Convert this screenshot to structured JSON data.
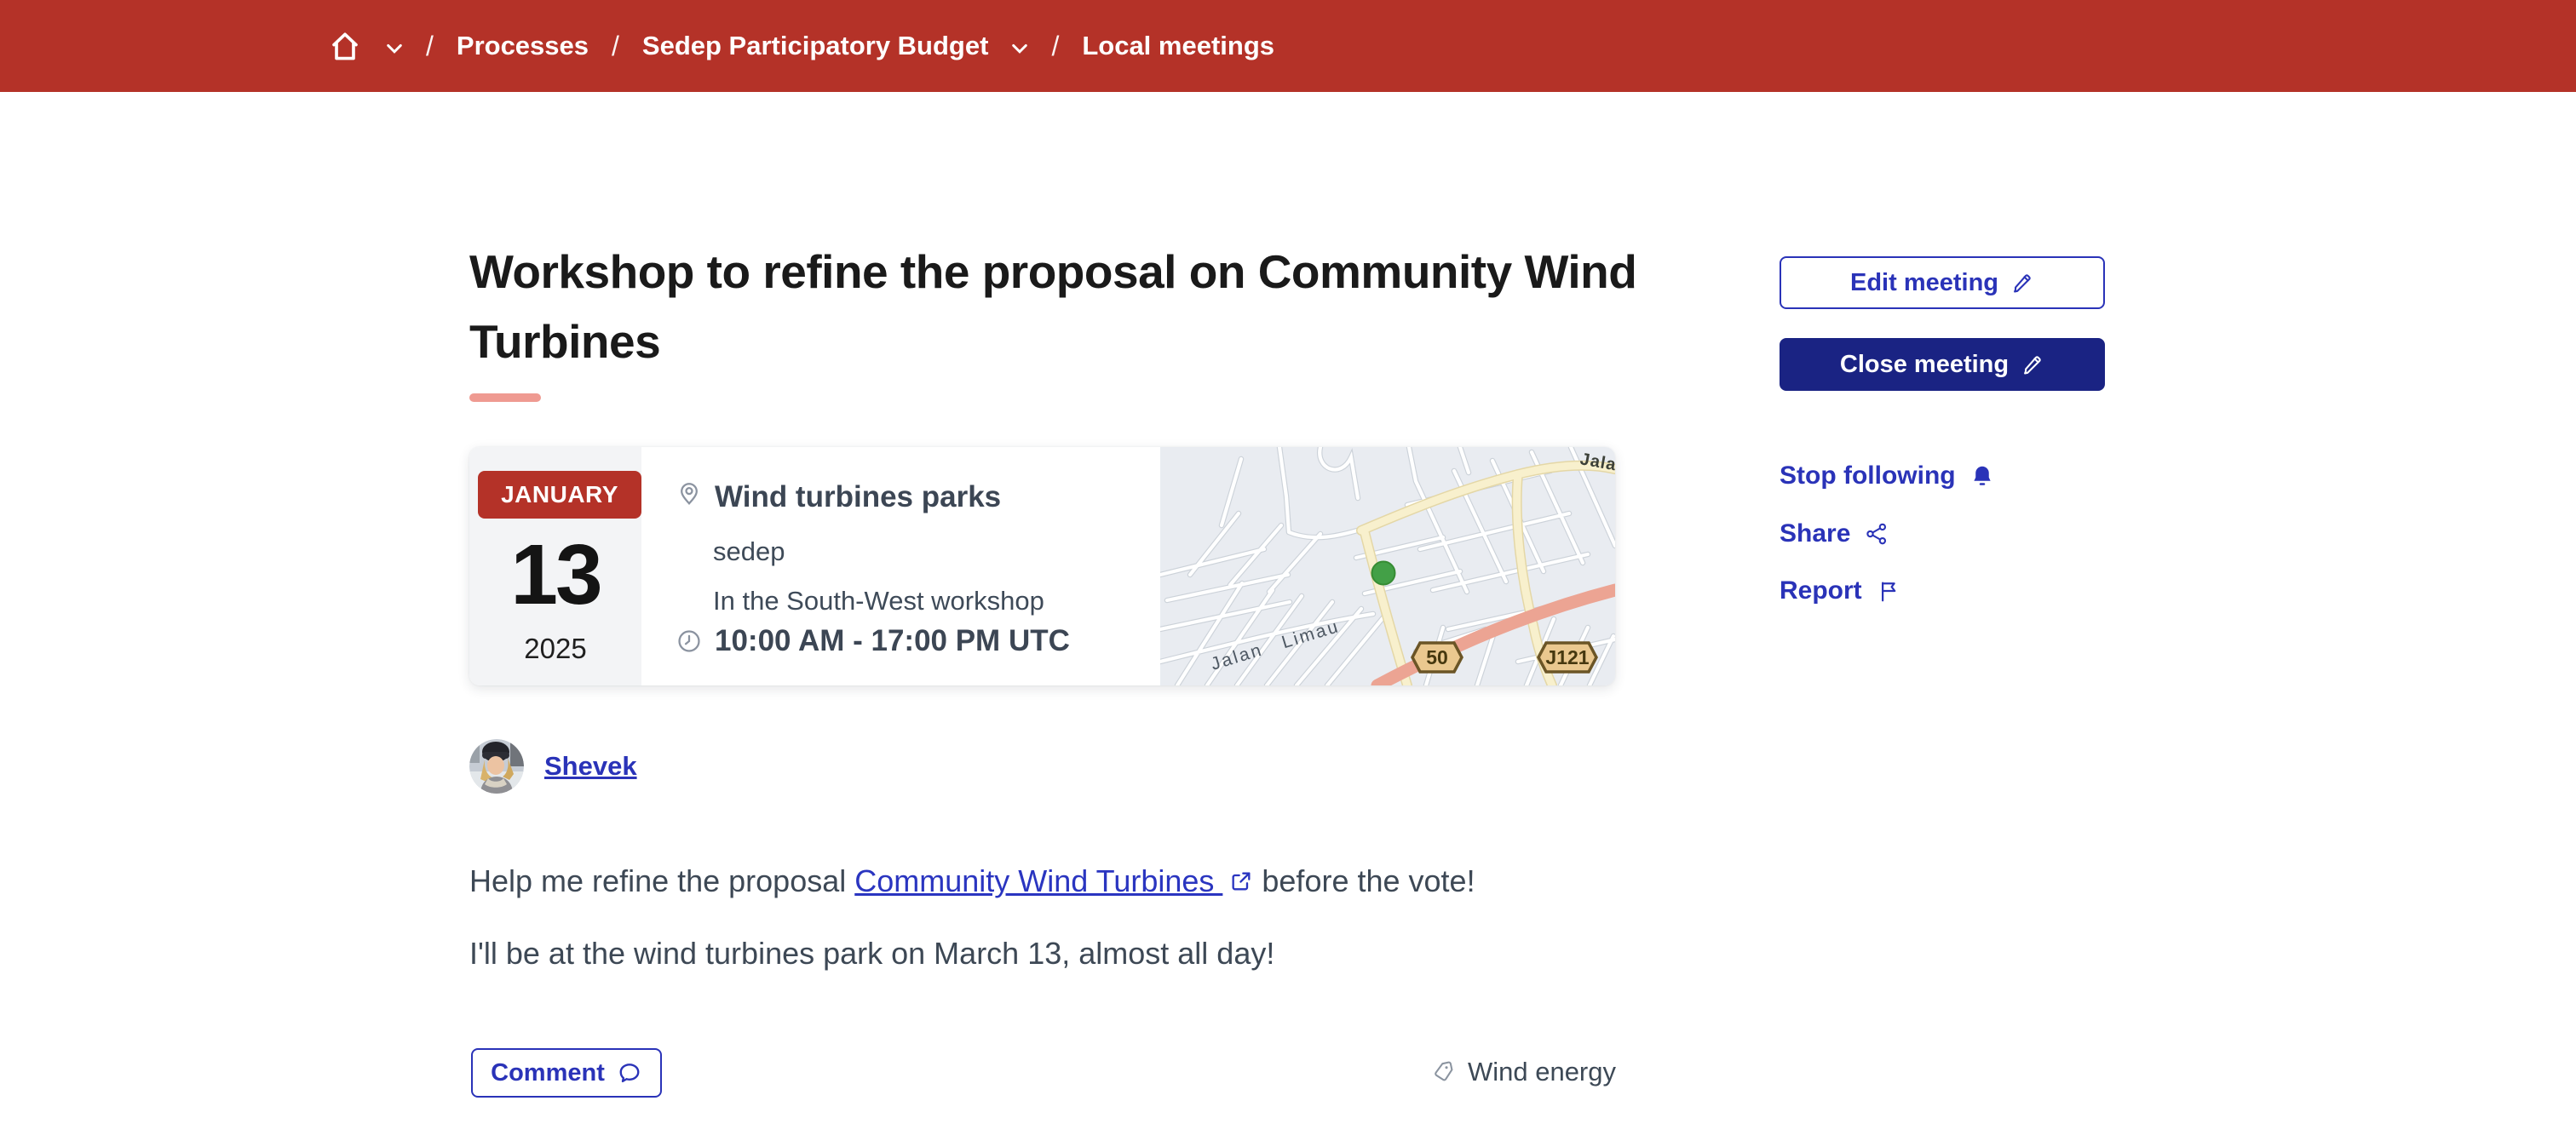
{
  "colors": {
    "topbar_red": "#b43228",
    "title_underline_salmon": "#ef9a91",
    "primary_blue": "#2a33b8",
    "close_button_navy": "#1a2383",
    "heading_text": "#1a1a1a",
    "body_text": "#3d4855",
    "card_gray": "#f3f4f6",
    "map_background": "#e9ecf1",
    "map_marker_green": "#43a047"
  },
  "breadcrumb": {
    "separator": "/",
    "items": [
      {
        "label": "Processes"
      },
      {
        "label": "Sedep Participatory Budget"
      },
      {
        "label": "Local meetings"
      }
    ]
  },
  "meeting": {
    "title": "Workshop to refine the proposal on Community Wind Turbines",
    "date": {
      "month": "JANUARY",
      "day": "13",
      "year": "2025"
    },
    "location": {
      "name": "Wind turbines parks",
      "org": "sedep",
      "detail": "In the South-West workshop"
    },
    "time": "10:00 AM - 17:00 PM UTC",
    "author": {
      "name": "Shevek"
    },
    "body": {
      "p1_prefix": "Help me refine the proposal ",
      "p1_link": "Community Wind Turbines ",
      "p1_suffix": " before the vote!",
      "p2": "I'll be at the wind turbines park on March 13, almost all day!"
    },
    "tag": "Wind energy"
  },
  "actions": {
    "edit_label": "Edit meeting",
    "close_label": "Close meeting",
    "follow_label": "Stop following",
    "share_label": "Share",
    "report_label": "Report",
    "comment_label": "Comment"
  },
  "map": {
    "street_label": "Jalan Limau",
    "corner_label": "Jala",
    "route_badges": [
      "50",
      "J121"
    ]
  }
}
